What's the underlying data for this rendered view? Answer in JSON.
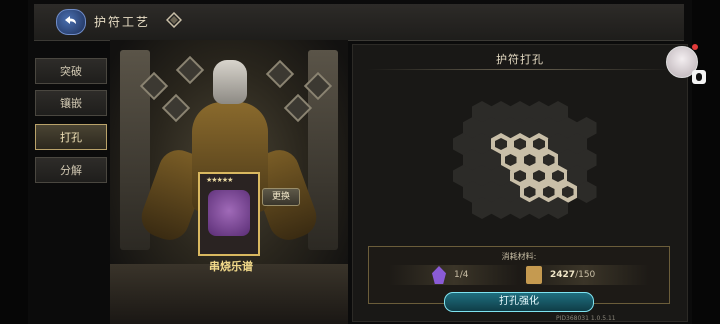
{
  "header": {
    "title": "护符工艺",
    "back_icon": "back-arrow-icon",
    "help_icon": "diamond-help-icon"
  },
  "sidebar": {
    "items": [
      {
        "label": "突破",
        "active": false
      },
      {
        "label": "镶嵌",
        "active": false
      },
      {
        "label": "打孔",
        "active": true
      },
      {
        "label": "分解",
        "active": false
      }
    ]
  },
  "item": {
    "name": "串烧乐谱",
    "stars": "★★★★★",
    "swap_label": "更换"
  },
  "panel": {
    "title": "护符打孔",
    "cost_label": "消耗材料:",
    "cost_a": "1/4",
    "cost_b_have": "2427",
    "cost_b_need": "/150",
    "action_label": "打孔强化",
    "build_id": "PID368031 1.0.5.11"
  },
  "colors": {
    "accent_gold": "#d9b860",
    "accent_cyan": "#7fe3f0",
    "crystal": "#8a5bd6"
  }
}
